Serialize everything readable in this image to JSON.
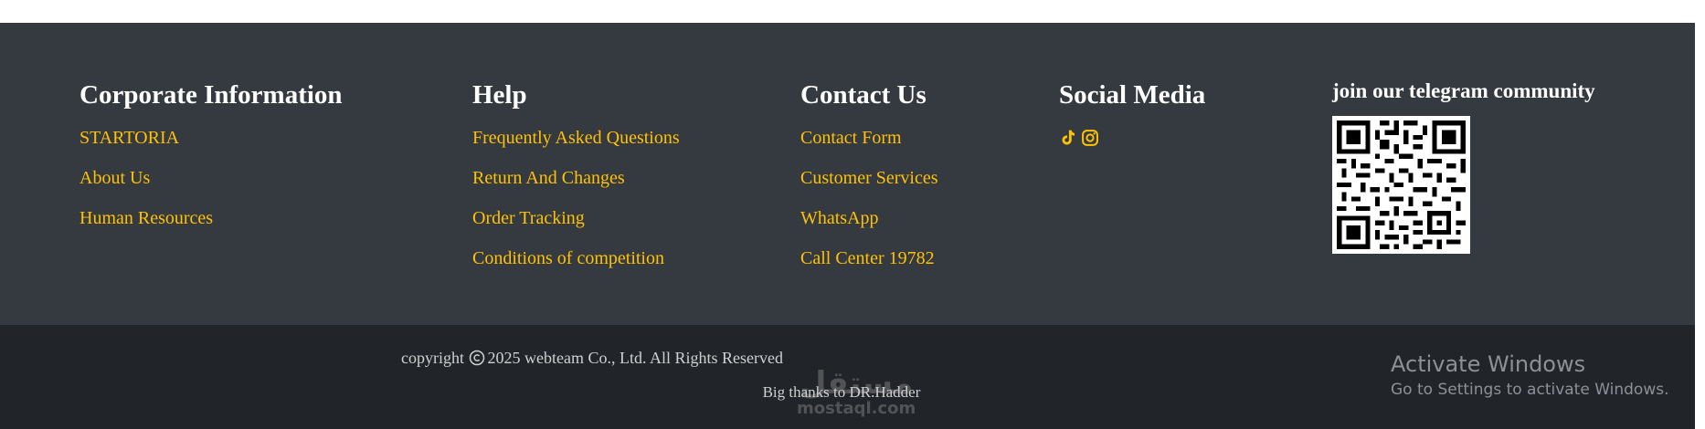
{
  "columns": {
    "corporate": {
      "title": "Corporate Information",
      "links": [
        "STARTORIA",
        "About Us",
        "Human Resources"
      ]
    },
    "help": {
      "title": "Help",
      "links": [
        "Frequently Asked Questions",
        "Return And Changes",
        "Order Tracking",
        "Conditions of competition"
      ]
    },
    "contact": {
      "title": "Contact Us",
      "links": [
        "Contact Form",
        "Customer Services",
        "WhatsApp",
        "Call Center 19782"
      ]
    },
    "social": {
      "title": "Social Media",
      "icons": [
        "tiktok-icon",
        "instagram-icon"
      ]
    },
    "telegram": {
      "title": "join our telegram community",
      "qr": "telegram-qr-code"
    }
  },
  "bottom": {
    "copyright": "copyright",
    "copyright_rest": "2025 webteam Co., Ltd. All Rights Reserved",
    "thanks": "Big thanks to DR.Hadder"
  },
  "watermark": {
    "arabic": "مستقل",
    "latin": "mostaql.com"
  },
  "activation": {
    "title": "Activate Windows",
    "subtitle": "Go to Settings to activate Windows."
  },
  "colors": {
    "footer_bg": "#343a40",
    "bottom_bg": "#212529",
    "link": "#ffc107",
    "heading": "#ffffff"
  }
}
